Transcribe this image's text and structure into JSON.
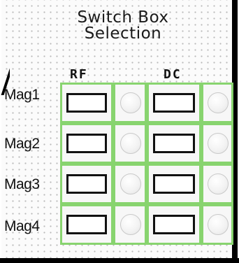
{
  "title_line1": "Switch Box",
  "title_line2": "Selection",
  "columns": {
    "rf": "RF",
    "dc": "DC"
  },
  "rows": [
    {
      "label": "Mag1"
    },
    {
      "label": "Mag2"
    },
    {
      "label": "Mag3"
    },
    {
      "label": "Mag4"
    }
  ],
  "colors": {
    "cell_border": "#88d46f",
    "button_border": "#111111",
    "led_off": "#eeeeee"
  }
}
